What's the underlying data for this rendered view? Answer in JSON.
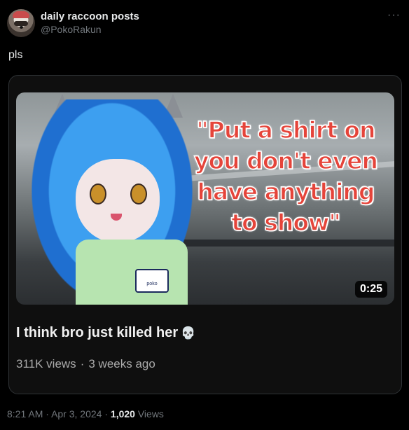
{
  "post": {
    "display_name": "daily raccoon posts",
    "handle": "@PokoRakun",
    "text": "pls",
    "more_label": "···"
  },
  "embed": {
    "thumbnail_caption": "\"Put a shirt on you don't even have anything to show\"",
    "name_tag": "poko",
    "duration": "0:25",
    "title": "I think bro just killed her",
    "title_emoji": "💀",
    "views": "311K views",
    "separator": "·",
    "age": "3 weeks ago"
  },
  "footer": {
    "time": "8:21 AM",
    "separator": "·",
    "date": "Apr 3, 2024",
    "views_count": "1,020",
    "views_label": "Views"
  }
}
